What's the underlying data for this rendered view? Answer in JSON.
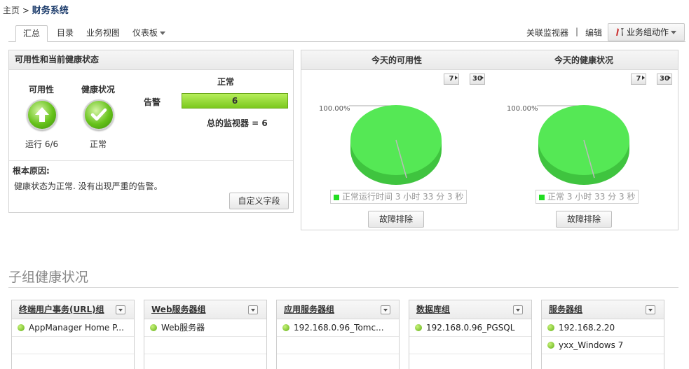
{
  "breadcrumb": {
    "home": "主页",
    "sep": ">",
    "current": "财务系统"
  },
  "tabs": [
    {
      "label": "汇总"
    },
    {
      "label": "目录"
    },
    {
      "label": "业务视图"
    },
    {
      "label": "仪表板"
    }
  ],
  "toolbar": {
    "link_monitor": "关联监视器",
    "sep": "|",
    "edit": "编辑",
    "actions": "业务组动作"
  },
  "health": {
    "title": "可用性和当前健康状态",
    "availability_label": "可用性",
    "health_label": "健康状况",
    "availability_status": "运行 6/6",
    "health_status": "正常",
    "alarm_header": "正常",
    "alarm_label": "告警",
    "alarm_count": "6",
    "total_monitors": "总的监视器 = 6",
    "root_cause_label": "根本原因:",
    "root_cause_text": "健康状态为正常. 没有出现严重的告警。",
    "custom_fields_button": "自定义字段"
  },
  "today": {
    "availability_title": "今天的可用性",
    "health_title": "今天的健康状况",
    "day7": "7",
    "day30": "30",
    "availability_pie_label": "100.00%",
    "health_pie_label": "100.00%",
    "availability_legend": "正常运行时间 3 小时 33 分 3 秒",
    "health_legend": "正常 3 小时 33 分 3 秒",
    "troubleshoot_button": "故障排除",
    "pie_color": "#55e855"
  },
  "subgroups": {
    "title": "子组健康状况",
    "groups": [
      {
        "title": "终端用户事务(URL)组",
        "items": [
          "AppManager Home P..."
        ]
      },
      {
        "title": "Web服务器组",
        "items": [
          "Web服务器"
        ]
      },
      {
        "title": "应用服务器组",
        "items": [
          "192.168.0.96_Tomc..."
        ]
      },
      {
        "title": "数据库组",
        "items": [
          "192.168.0.96_PGSQL"
        ]
      },
      {
        "title": "服务器组",
        "items": [
          "192.168.2.20",
          "yxx_Windows 7"
        ]
      }
    ]
  }
}
